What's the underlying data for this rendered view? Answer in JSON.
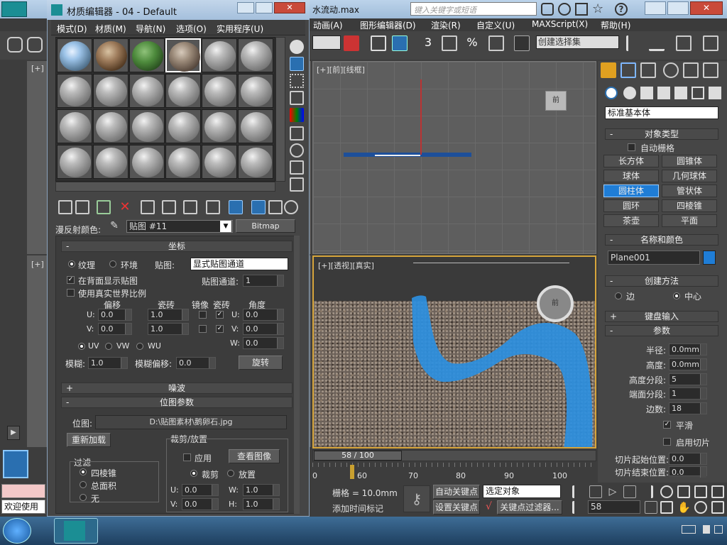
{
  "app": {
    "window_title_right": "水流动.max",
    "search_placeholder": "键入关键字或短语",
    "menus": [
      "动画(A)",
      "图形编辑器(D)",
      "渲染(R)",
      "自定义(U)",
      "MAXScript(X)",
      "帮助(H)"
    ],
    "selection_set": "创建选择集"
  },
  "mat": {
    "title": "材质编辑器 - 04 - Default",
    "menus": [
      "模式(D)",
      "材质(M)",
      "导航(N)",
      "选项(O)",
      "实用程序(U)"
    ],
    "diffuse_label": "漫反射颜色:",
    "map_name": "贴图 #11",
    "map_type": "Bitmap",
    "coord": {
      "header": "坐标",
      "texture": "纹理",
      "env": "环境",
      "map_label": "贴图:",
      "map_value": "显式贴图通道",
      "channel_label": "贴图通道:",
      "channel_value": "1",
      "show_back": "在背面显示贴图",
      "real_world": "使用真实世界比例",
      "offset": "偏移",
      "tiling": "瓷砖",
      "mirror": "镜像",
      "tile": "瓷砖",
      "angle": "角度",
      "u": "U:",
      "v": "V:",
      "w": "W:",
      "u_off": "0.0",
      "v_off": "0.0",
      "u_til": "1.0",
      "v_til": "1.0",
      "u_ang": "0.0",
      "v_ang": "0.0",
      "w_ang": "0.0",
      "uv": "UV",
      "vw": "VW",
      "wu": "WU",
      "blur": "模糊:",
      "blur_v": "1.0",
      "blur_off": "模糊偏移:",
      "blur_off_v": "0.0",
      "rotate": "旋转"
    },
    "noise": "噪波",
    "bitmap": {
      "header": "位图参数",
      "path_label": "位图:",
      "path": "D:\\贴图素材\\鹅卵石.jpg",
      "reload": "重新加载",
      "crop": "裁剪/放置",
      "apply": "应用",
      "view": "查看图像",
      "crop_opt": "裁剪",
      "place_opt": "放置",
      "filter": "过滤",
      "f1": "四棱锥",
      "f2": "总面积",
      "f3": "无",
      "u": "U:",
      "v": "V:",
      "w": "W:",
      "h": "H:",
      "u_v": "0.0",
      "v_v": "0.0",
      "w_v": "1.0",
      "h_v": "1.0"
    }
  },
  "viewports": {
    "front": "[+][前][线框]",
    "persp": "[+][透视][真实]",
    "left_top": "[+]",
    "left_mid": "[+]",
    "cube_top": "前",
    "cube_persp": "前"
  },
  "timeline": {
    "frame": "58 / 100",
    "ticks": [
      "0",
      "60",
      "70",
      "80",
      "90",
      "100"
    ]
  },
  "status": {
    "welcome": "欢迎使用",
    "grid": "栅格 = 10.0mm",
    "add_tag": "添加时间标记",
    "autokey": "自动关键点",
    "setkey": "设置关键点",
    "sel_obj": "选定对象",
    "key_filter": "关键点过滤器...",
    "frame_field": "58"
  },
  "cmd": {
    "dropdown": "标准基本体",
    "obj_type": "对象类型",
    "autogrid": "自动栅格",
    "buttons": [
      "长方体",
      "圆锥体",
      "球体",
      "几何球体",
      "圆柱体",
      "管状体",
      "圆环",
      "四棱锥",
      "茶壶",
      "平面"
    ],
    "name_color": "名称和颜色",
    "obj_name": "Plane001",
    "create_method": "创建方法",
    "edge": "边",
    "center": "中心",
    "kbd": "键盘输入",
    "params": "参数",
    "radius": "半径:",
    "radius_v": "0.0mm",
    "height": "高度:",
    "height_v": "0.0mm",
    "hseg": "高度分段:",
    "hseg_v": "5",
    "cseg": "端面分段:",
    "cseg_v": "1",
    "sides": "边数:",
    "sides_v": "18",
    "smooth": "平滑",
    "slice": "启用切片",
    "slice_from": "切片起始位置:",
    "slice_to": "切片结束位置:",
    "slice_v": "0.0"
  },
  "colors": {
    "accent": "#1f7dd6",
    "water": "#2d8fe0",
    "bg": "#3d3d3d"
  }
}
